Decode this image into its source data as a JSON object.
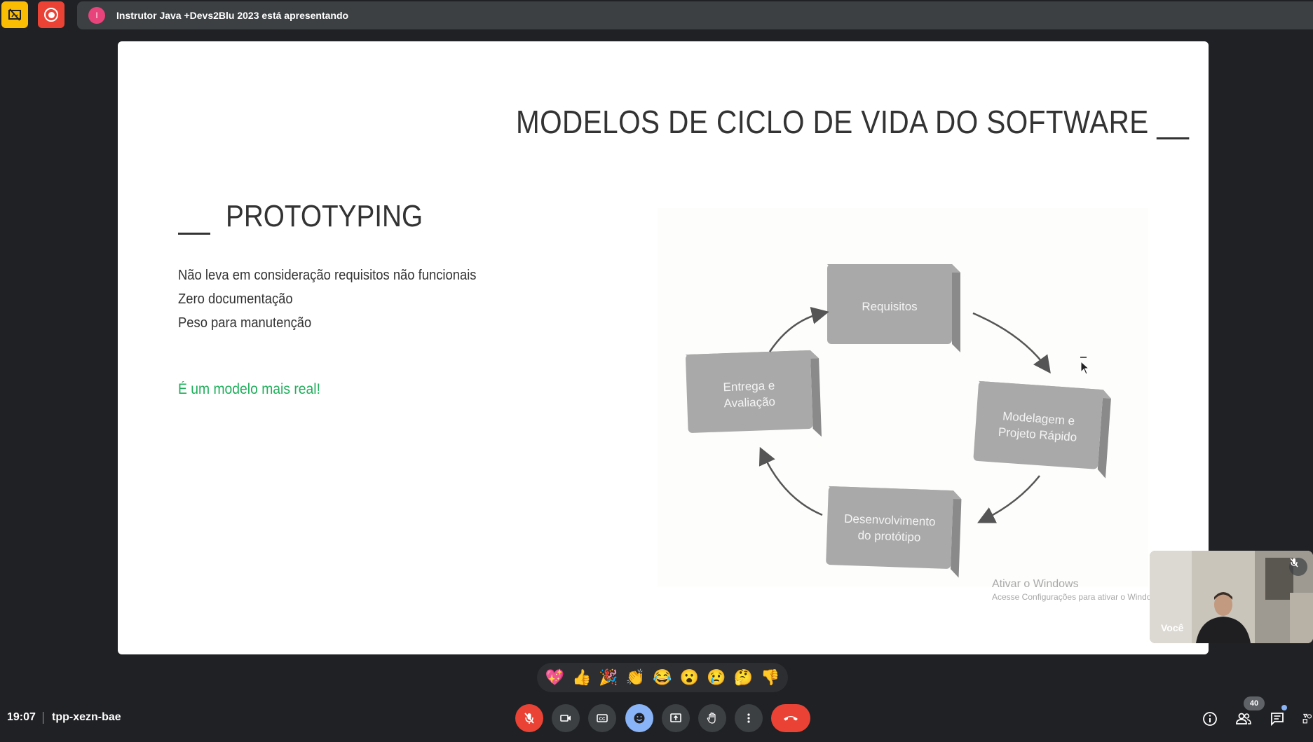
{
  "topbar": {
    "pin_icon": "hide-tile-icon",
    "record_icon": "recording-icon",
    "presenter_initial": "I",
    "presenting_text": "Instrutor Java +Devs2Blu 2023 está apresentando"
  },
  "slide": {
    "title": "MODELOS DE CICLO DE VIDA DO SOFTWARE __",
    "section_heading": "PROTOTYPING",
    "bullets": [
      "Não leva em consideração requisitos não funcionais",
      "Zero documentação",
      "Peso para manutenção"
    ],
    "highlight": "É um modelo mais real!",
    "highlight_color": "#1fae5a",
    "diagram": {
      "boxes": {
        "requisitos": "Requisitos",
        "modelagem_line1": "Modelagem e",
        "modelagem_line2": "Projeto Rápido",
        "desenvolvimento_line1": "Desenvolvimento",
        "desenvolvimento_line2": "do protótipo",
        "entrega_line1": "Entrega e",
        "entrega_line2": "Avaliação"
      }
    },
    "watermark_line1": "Ativar o Windows",
    "watermark_line2": "Acesse Configurações para ativar o Windo"
  },
  "self_tile": {
    "name": "Você",
    "mic_icon": "mic-off-icon"
  },
  "reactions": [
    "💖",
    "👍",
    "🎉",
    "👏",
    "😂",
    "😮",
    "😢",
    "🤔",
    "👎"
  ],
  "bottombar": {
    "time": "19:07",
    "meeting_code": "tpp-xezn-bae",
    "people_count": "40",
    "accent_color": "#8ab4f8",
    "danger_color": "#ea4335"
  }
}
